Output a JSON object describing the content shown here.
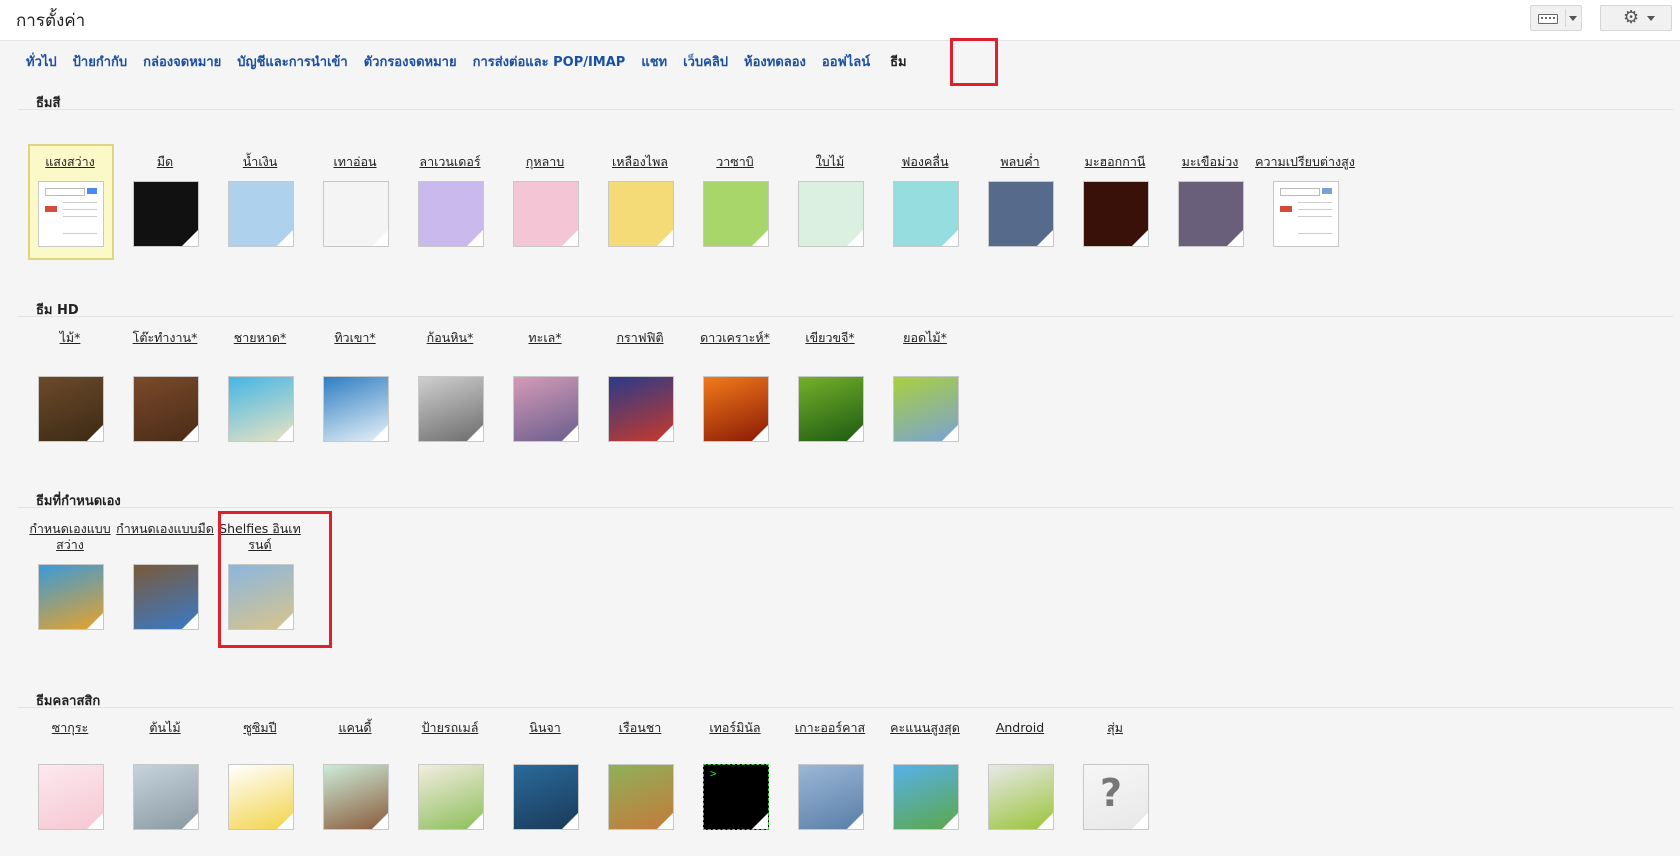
{
  "page": {
    "title": "การตั้งค่า"
  },
  "tabs": [
    {
      "label": "ทั่วไป"
    },
    {
      "label": "ป้ายกำกับ"
    },
    {
      "label": "กล่องจดหมาย"
    },
    {
      "label": "บัญชีและการนำเข้า"
    },
    {
      "label": "ตัวกรองจดหมาย"
    },
    {
      "label": "การส่งต่อและ POP/IMAP"
    },
    {
      "label": "แชท"
    },
    {
      "label": "เว็บคลิป"
    },
    {
      "label": "ห้องทดลอง"
    },
    {
      "label": "ออฟไลน์"
    },
    {
      "label": "ธีม",
      "active": true
    }
  ],
  "sections": {
    "color": {
      "title": "ธีมสี"
    },
    "hd": {
      "title": "ธีม HD"
    },
    "custom": {
      "title": "ธีมที่กำหนดเอง"
    },
    "classic": {
      "title": "ธีมคลาสสิก"
    }
  },
  "color_themes": [
    {
      "label": "แสงสว่าง",
      "color": "#ffffff",
      "selected": true,
      "preview": "light"
    },
    {
      "label": "มืด",
      "color": "#111111"
    },
    {
      "label": "น้ำเงิน",
      "color": "#aed2ee"
    },
    {
      "label": "เทาอ่อน",
      "color": "#f4f4f4"
    },
    {
      "label": "ลาเวนเดอร์",
      "color": "#c9b9ec"
    },
    {
      "label": "กุหลาบ",
      "color": "#f4c5d5"
    },
    {
      "label": "เหลืองไพล",
      "color": "#f5db77"
    },
    {
      "label": "วาซาบิ",
      "color": "#a8d66b"
    },
    {
      "label": "ใบไม้",
      "color": "#dbf0e1"
    },
    {
      "label": "ฟองคลื่น",
      "color": "#95dddf"
    },
    {
      "label": "พลบค่ำ",
      "color": "#566a8b"
    },
    {
      "label": "มะฮอกกานี",
      "color": "#3a1108"
    },
    {
      "label": "มะเขือม่วง",
      "color": "#6a5f7a"
    },
    {
      "label": "ความเปรียบต่างสูง",
      "color": "#ffffff",
      "preview": "contrast"
    }
  ],
  "hd_themes": [
    {
      "label": "ไม้*",
      "colors": [
        "#6b4a2a",
        "#3d2a16"
      ]
    },
    {
      "label": "โต๊ะทำงาน*",
      "colors": [
        "#7a4a2a",
        "#4a2b18"
      ]
    },
    {
      "label": "ชายหาด*",
      "colors": [
        "#45b6e6",
        "#e9e3c2"
      ]
    },
    {
      "label": "ทิวเขา*",
      "colors": [
        "#2f7ec2",
        "#e8f1f8"
      ]
    },
    {
      "label": "ก้อนหิน*",
      "colors": [
        "#cfcfcf",
        "#6d6d6d"
      ]
    },
    {
      "label": "ทะเล*",
      "colors": [
        "#d49bb6",
        "#6a5e8e"
      ]
    },
    {
      "label": "กราฟฟิติ",
      "colors": [
        "#2a3a8a",
        "#c83a2a"
      ]
    },
    {
      "label": "ดาวเคราะห์*",
      "colors": [
        "#f27a1a",
        "#8a1a05"
      ]
    },
    {
      "label": "เขียวขจี*",
      "colors": [
        "#74b02a",
        "#1e5a12"
      ]
    },
    {
      "label": "ยอดไม้*",
      "colors": [
        "#a9cf3f",
        "#7aa3d2"
      ]
    }
  ],
  "custom_themes": [
    {
      "label": "กำหนดเองแบบสว่าง",
      "colors": [
        "#3a9ad9",
        "#e8a22a"
      ]
    },
    {
      "label": "กำหนดเองแบบมืด",
      "colors": [
        "#7a5a3a",
        "#3a7ac9"
      ]
    },
    {
      "label": "Shelfies อินเทรนด์",
      "colors": [
        "#8ab6e0",
        "#d9c48a"
      ]
    }
  ],
  "classic_themes": [
    {
      "label": "ซากุระ",
      "colors": [
        "#fde8ee",
        "#f5c7d3"
      ]
    },
    {
      "label": "ต้นไม้",
      "colors": [
        "#c6d3dc",
        "#8a9aa3"
      ]
    },
    {
      "label": "ซูซิมปี",
      "colors": [
        "#ffffff",
        "#f2d34a"
      ]
    },
    {
      "label": "แคนดี้",
      "colors": [
        "#ccecd9",
        "#8a5a3a"
      ]
    },
    {
      "label": "ป้ายรถเมล์",
      "colors": [
        "#f3ece0",
        "#8cbf5a"
      ]
    },
    {
      "label": "นินจา",
      "colors": [
        "#2a6a9a",
        "#1a3a5a"
      ]
    },
    {
      "label": "เรือนชา",
      "colors": [
        "#8fb05a",
        "#c47a3a"
      ]
    },
    {
      "label": "เทอร์มินัล",
      "colors": [
        "#000000",
        "#000000"
      ],
      "terminal": true
    },
    {
      "label": "เกาะออร์คาส",
      "colors": [
        "#9ab8d6",
        "#5a7ea8"
      ]
    },
    {
      "label": "คะแนนสูงสุด",
      "colors": [
        "#58b0e8",
        "#5aa84a"
      ]
    },
    {
      "label": "Android",
      "colors": [
        "#e8e8e8",
        "#9ac43a"
      ]
    },
    {
      "label": "สุ่ม",
      "colors": [
        "#f6f6f6",
        "#e8e8e8"
      ],
      "random": true
    }
  ]
}
